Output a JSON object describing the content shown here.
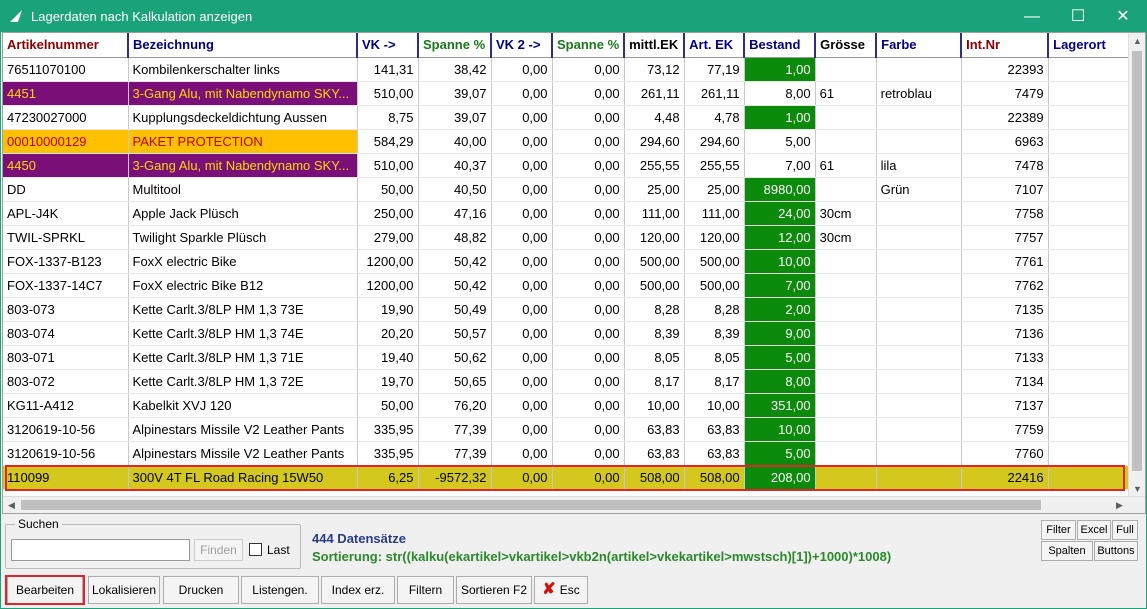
{
  "window": {
    "title": "Lagerdaten nach Kalkulation anzeigen",
    "minimize": "—",
    "maximize": "☐",
    "close": "✕"
  },
  "columns": [
    {
      "label": "Artikelnummer",
      "color": "#8b0000"
    },
    {
      "label": "Bezeichnung",
      "color": "#000080"
    },
    {
      "label": "VK ->",
      "color": "#000080"
    },
    {
      "label": "Spanne %",
      "color": "#1a7a1a"
    },
    {
      "label": "VK 2 ->",
      "color": "#000080"
    },
    {
      "label": "Spanne %",
      "color": "#1a7a1a"
    },
    {
      "label": "mittl.EK",
      "color": "#000000"
    },
    {
      "label": "Art. EK",
      "color": "#000080"
    },
    {
      "label": "Bestand",
      "color": "#000080"
    },
    {
      "label": "Grösse",
      "color": "#000000"
    },
    {
      "label": "Farbe",
      "color": "#000080"
    },
    {
      "label": "Int.Nr",
      "color": "#8b0000"
    },
    {
      "label": "Lagerort",
      "color": "#000080"
    }
  ],
  "rows": [
    {
      "style": "",
      "cells": [
        "76511070100",
        "Kombilenkerschalter links",
        "141,31",
        "38,42",
        "0,00",
        "0,00",
        "73,12",
        "77,19",
        "1,00",
        "",
        "",
        "22393",
        ""
      ]
    },
    {
      "style": "purple",
      "cells": [
        "4451",
        "3-Gang Alu, mit Nabendynamo SKY...",
        "510,00",
        "39,07",
        "0,00",
        "0,00",
        "261,11",
        "261,11",
        "8,00",
        "61",
        "retroblau",
        "7479",
        ""
      ]
    },
    {
      "style": "",
      "cells": [
        "47230027000",
        "Kupplungsdeckeldichtung Aussen",
        "8,75",
        "39,07",
        "0,00",
        "0,00",
        "4,48",
        "4,78",
        "1,00",
        "",
        "",
        "22389",
        ""
      ]
    },
    {
      "style": "orange",
      "cells": [
        "00010000129",
        "PAKET PROTECTION",
        "584,29",
        "40,00",
        "0,00",
        "0,00",
        "294,60",
        "294,60",
        "5,00",
        "",
        "",
        "6963",
        ""
      ]
    },
    {
      "style": "purple",
      "cells": [
        "4450",
        "3-Gang Alu, mit Nabendynamo SKY...",
        "510,00",
        "40,37",
        "0,00",
        "0,00",
        "255,55",
        "255,55",
        "7,00",
        "61",
        "lila",
        "7478",
        ""
      ]
    },
    {
      "style": "",
      "cells": [
        "DD",
        "Multitool",
        "50,00",
        "40,50",
        "0,00",
        "0,00",
        "25,00",
        "25,00",
        "8980,00",
        "",
        "Grün",
        "7107",
        ""
      ]
    },
    {
      "style": "",
      "cells": [
        "APL-J4K",
        "Apple Jack Plüsch",
        "250,00",
        "47,16",
        "0,00",
        "0,00",
        "111,00",
        "111,00",
        "24,00",
        "30cm",
        "",
        "7758",
        ""
      ]
    },
    {
      "style": "",
      "cells": [
        "TWIL-SPRKL",
        "Twilight Sparkle Plüsch",
        "279,00",
        "48,82",
        "0,00",
        "0,00",
        "120,00",
        "120,00",
        "12,00",
        "30cm",
        "",
        "7757",
        ""
      ]
    },
    {
      "style": "",
      "cells": [
        "FOX-1337-B123",
        "FoxX electric Bike",
        "1200,00",
        "50,42",
        "0,00",
        "0,00",
        "500,00",
        "500,00",
        "10,00",
        "",
        "",
        "7761",
        ""
      ]
    },
    {
      "style": "",
      "cells": [
        "FOX-1337-14C7",
        "FoxX electric Bike B12",
        "1200,00",
        "50,42",
        "0,00",
        "0,00",
        "500,00",
        "500,00",
        "7,00",
        "",
        "",
        "7762",
        ""
      ]
    },
    {
      "style": "",
      "cells": [
        "803-073",
        "Kette Carlt.3/8LP HM 1,3 73E",
        "19,90",
        "50,49",
        "0,00",
        "0,00",
        "8,28",
        "8,28",
        "2,00",
        "",
        "",
        "7135",
        ""
      ]
    },
    {
      "style": "",
      "cells": [
        "803-074",
        "Kette Carlt.3/8LP HM 1,3 74E",
        "20,20",
        "50,57",
        "0,00",
        "0,00",
        "8,39",
        "8,39",
        "9,00",
        "",
        "",
        "7136",
        ""
      ]
    },
    {
      "style": "",
      "cells": [
        "803-071",
        "Kette Carlt.3/8LP HM 1,3 71E",
        "19,40",
        "50,62",
        "0,00",
        "0,00",
        "8,05",
        "8,05",
        "5,00",
        "",
        "",
        "7133",
        ""
      ]
    },
    {
      "style": "",
      "cells": [
        "803-072",
        "Kette Carlt.3/8LP HM 1,3 72E",
        "19,70",
        "50,65",
        "0,00",
        "0,00",
        "8,17",
        "8,17",
        "8,00",
        "",
        "",
        "7134",
        ""
      ]
    },
    {
      "style": "",
      "cells": [
        "KG11-A412",
        "Kabelkit XVJ 120",
        "50,00",
        "76,20",
        "0,00",
        "0,00",
        "10,00",
        "10,00",
        "351,00",
        "",
        "",
        "7137",
        ""
      ]
    },
    {
      "style": "",
      "cells": [
        "3120619-10-56",
        "Alpinestars Missile V2 Leather Pants",
        "335,95",
        "77,39",
        "0,00",
        "0,00",
        "63,83",
        "63,83",
        "10,00",
        "",
        "",
        "7759",
        ""
      ]
    },
    {
      "style": "",
      "cells": [
        "3120619-10-56",
        "Alpinestars Missile V2 Leather Pants",
        "335,95",
        "77,39",
        "0,00",
        "0,00",
        "63,83",
        "63,83",
        "5,00",
        "",
        "",
        "7760",
        ""
      ]
    },
    {
      "style": "selected",
      "cells": [
        "110099",
        "300V 4T FL Road Racing 15W50",
        "6,25",
        "-9572,32",
        "0,00",
        "0,00",
        "508,00",
        "508,00",
        "208,00",
        "",
        "",
        "22416",
        ""
      ]
    }
  ],
  "search": {
    "legend": "Suchen",
    "value": "",
    "find_button": "Finden",
    "last_label": "Last"
  },
  "status": {
    "count": "444 Datensätze",
    "sort": "Sortierung: str((kalku(ekartikel>vkartikel>vkb2n(artikel>vkekartikel>mwstsch)[1])+1000)*1008)"
  },
  "side_buttons": [
    "Filter",
    "Excel",
    "Full",
    "Spalten",
    "Buttons"
  ],
  "buttons": [
    "Bearbeiten",
    "Lokalisieren",
    "Drucken",
    "Listengen.",
    "Index erz.",
    "Filtern",
    "Sortieren F2",
    "Esc"
  ]
}
